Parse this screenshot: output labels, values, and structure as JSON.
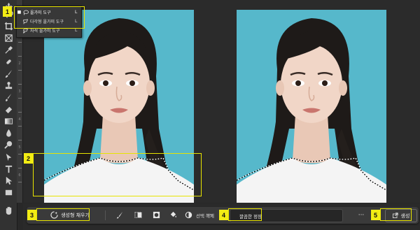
{
  "flyout": {
    "items": [
      {
        "label": "올가미 도구",
        "shortcut": "L",
        "icon": "lasso-icon",
        "active": true
      },
      {
        "label": "다각형 올가미 도구",
        "shortcut": "L",
        "icon": "polygonal-lasso-icon",
        "active": false
      },
      {
        "label": "자석 올가미 도구",
        "shortcut": "L",
        "icon": "magnetic-lasso-icon",
        "active": false
      }
    ]
  },
  "tools": [
    "move-icon",
    "lasso-icon",
    "crop-icon",
    "frame-icon",
    "eyedropper-icon",
    "spot-healing-icon",
    "brush-icon",
    "clone-stamp-icon",
    "history-brush-icon",
    "eraser-icon",
    "gradient-icon",
    "blur-icon",
    "dodge-icon",
    "pen-icon",
    "type-icon",
    "path-select-icon",
    "rectangle-icon",
    "hand-icon"
  ],
  "ruler": {
    "labels": [
      "1",
      "2",
      "3",
      "4",
      "5",
      "6",
      "7",
      "8",
      "9",
      "0"
    ]
  },
  "contextual_bar": {
    "generative_fill_label": "생성형 채우기",
    "deselect_label": "선택 해제",
    "prompt_value": "깔끔한 정장",
    "more_label": "···",
    "generate_label": "생성"
  },
  "badges": [
    "1",
    "2",
    "3",
    "4",
    "5"
  ],
  "colors": {
    "highlight": "#e8e400",
    "badge": "#f2ec14",
    "background": "#56b8cb"
  }
}
